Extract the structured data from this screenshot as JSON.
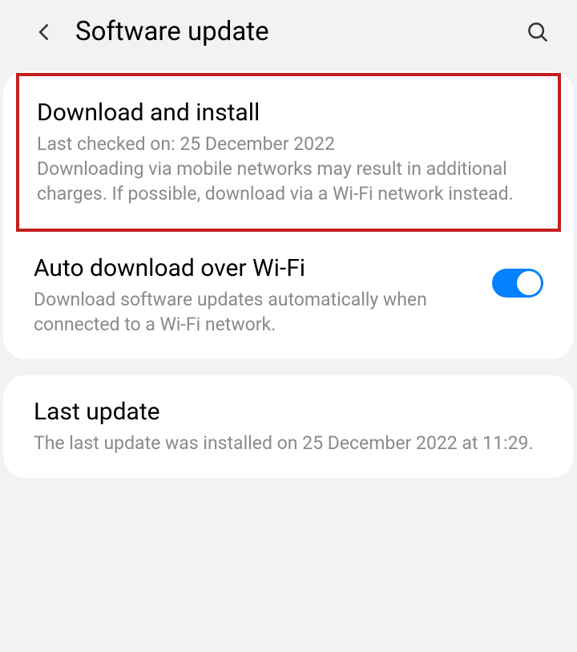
{
  "header": {
    "title": "Software update"
  },
  "downloadInstall": {
    "title": "Download and install",
    "lastChecked": "Last checked on: 25 December 2022",
    "warning": "Downloading via mobile networks may result in additional charges. If possible, download via a Wi-Fi network instead."
  },
  "autoDownload": {
    "title": "Auto download over Wi-Fi",
    "description": "Download software updates automatically when connected to a Wi-Fi network.",
    "enabled": true
  },
  "lastUpdate": {
    "title": "Last update",
    "description": "The last update was installed on 25 December 2022 at 11:29."
  }
}
